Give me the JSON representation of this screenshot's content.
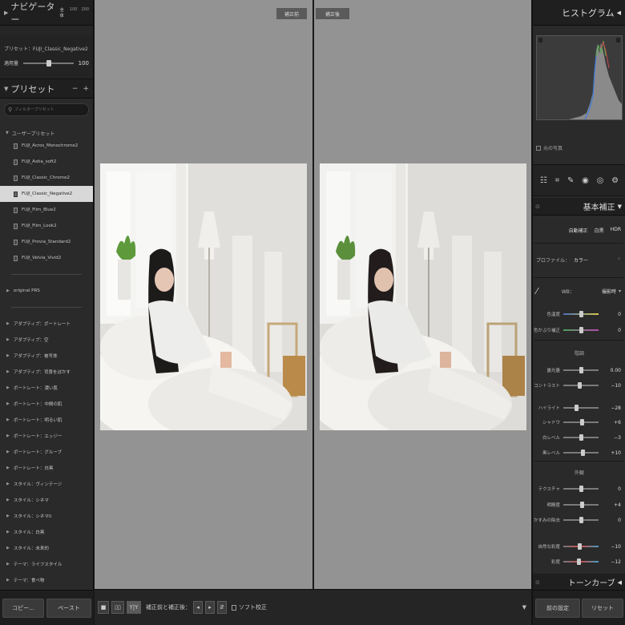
{
  "navigator": {
    "title": "ナビゲーター",
    "zoom_fit": "全体",
    "zoom_100": "100",
    "zoom_200": "200"
  },
  "preset_info": {
    "preset_label": "プリセット：FUJI_Classic_Negative2",
    "amount_label": "適用量",
    "amount_value": "100",
    "amount_fraction": 0.5
  },
  "presets": {
    "title": "プリセット",
    "minus": "−",
    "plus": "+",
    "filter_placeholder": "フィルタープリセット",
    "user_group": "ユーザープリセット",
    "user_items": [
      "FUJI_Acros_Monochrome2",
      "FUJI_Astia_soft2",
      "FUJI_Classic_Chrome2",
      "FUJI_Classic_Negative2",
      "FUJI_Film_Blue2",
      "FUJI_Film_Look2",
      "FUJI_Provia_Standard2",
      "FUJI_Velvia_Vivid2"
    ],
    "selected_index": 3,
    "folder_original": "original PRS",
    "folders": [
      "アダプティブ：ポートレート",
      "アダプティブ：空",
      "アダプティブ：被写体",
      "アダプティブ：背景をぼかす",
      "ポートレート：濃い肌",
      "ポートレート：中間の肌",
      "ポートレート：明るい肌",
      "ポートレート：エッジー",
      "ポートレート：グループ",
      "ポートレート：白黒",
      "スタイル：ヴィンテージ",
      "スタイル：シネマ",
      "スタイル：シネマII",
      "スタイル：白黒",
      "スタイル：未来的",
      "テーマ：ライフスタイル",
      "テーマ：食べ物"
    ]
  },
  "left_buttons": {
    "copy": "コピー...",
    "paste": "ペースト"
  },
  "compare": {
    "before": "補正前",
    "after": "補正後"
  },
  "toolbar": {
    "view_label": "補正前と補正後：",
    "soft_proof": "ソフト校正",
    "yy": "Y|Y"
  },
  "histogram": {
    "title": "ヒストグラム",
    "orig_photo": "元の写真"
  },
  "basic": {
    "title": "基本補正",
    "auto": "自動補正",
    "bw": "白黒",
    "hdr": "HDR",
    "profile_label": "プロファイル：",
    "profile_value": "カラー",
    "wb_label": "WB：",
    "wb_value": "撮影時",
    "tone_title": "階調",
    "presence_title": "外観",
    "sliders": [
      {
        "label": "色温度",
        "value": "0",
        "pos": 0.5,
        "style": "blue-yellow"
      },
      {
        "label": "色かぶり補正",
        "value": "0",
        "pos": 0.5,
        "style": "green-mag"
      },
      {
        "label": "露光量",
        "value": "0.00",
        "pos": 0.5,
        "style": ""
      },
      {
        "label": "コントラスト",
        "value": "−10",
        "pos": 0.45,
        "style": ""
      },
      {
        "label": "ハイライト",
        "value": "−28",
        "pos": 0.36,
        "style": ""
      },
      {
        "label": "シャドウ",
        "value": "+6",
        "pos": 0.53,
        "style": ""
      },
      {
        "label": "白レベル",
        "value": "−3",
        "pos": 0.49,
        "style": ""
      },
      {
        "label": "黒レベル",
        "value": "+10",
        "pos": 0.55,
        "style": ""
      },
      {
        "label": "テクスチャ",
        "value": "0",
        "pos": 0.5,
        "style": ""
      },
      {
        "label": "明瞭度",
        "value": "+4",
        "pos": 0.52,
        "style": ""
      },
      {
        "label": "かすみの除去",
        "value": "0",
        "pos": 0.5,
        "style": ""
      },
      {
        "label": "自然な彩度",
        "value": "−10",
        "pos": 0.45,
        "style": "sat"
      },
      {
        "label": "彩度",
        "value": "−12",
        "pos": 0.44,
        "style": "sat"
      }
    ]
  },
  "tone_curve": {
    "title": "トーンカーブ"
  },
  "right_buttons": {
    "previous": "前の設定",
    "reset": "リセット"
  },
  "colors": {
    "selected_bg": "#d8d8d8",
    "canvas_bg": "#939393",
    "panel_bg": "#2a2a2a"
  }
}
